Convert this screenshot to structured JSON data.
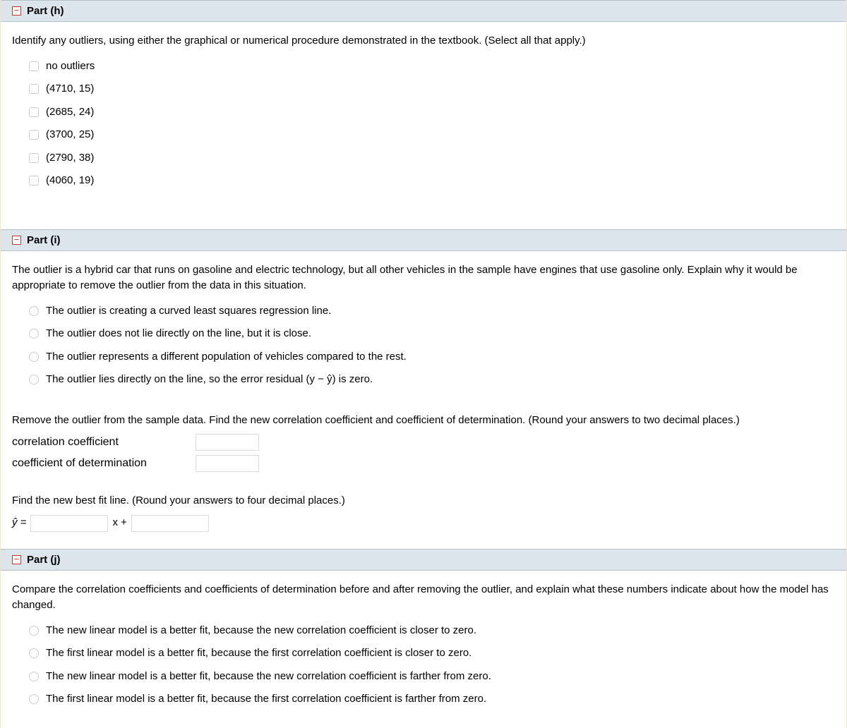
{
  "parts": {
    "h": {
      "title": "Part (h)",
      "question": "Identify any outliers, using either the graphical or numerical procedure demonstrated in the textbook. (Select all that apply.)",
      "options": [
        "no outliers",
        "(4710, 15)",
        "(2685, 24)",
        "(3700, 25)",
        "(2790, 38)",
        "(4060, 19)"
      ]
    },
    "i": {
      "title": "Part (i)",
      "question": "The outlier is a hybrid car that runs on gasoline and electric technology, but all other vehicles in the sample have engines that use gasoline only. Explain why it would be appropriate to remove the outlier from the data in this situation.",
      "options": [
        "The outlier is creating a curved least squares regression line.",
        "The outlier does not lie directly on the line, but it is close.",
        "The outlier represents a different population of vehicles compared to the rest.",
        "The outlier lies directly on the line, so the error residual (y − ŷ) is zero."
      ],
      "coeff_prompt": "Remove the outlier from the sample data. Find the new correlation coefficient and coefficient of determination. (Round your answers to two decimal places.)",
      "corr_label": "correlation coefficient",
      "det_label": "coefficient of determination",
      "bestfit_prompt": "Find the new best fit line. (Round your answers to four decimal places.)",
      "yhat_label": "ŷ =",
      "xplus_label": "x +"
    },
    "j": {
      "title": "Part (j)",
      "question": "Compare the correlation coefficients and coefficients of determination before and after removing the outlier, and explain what these numbers indicate about how the model has changed.",
      "options": [
        "The new linear model is a better fit, because the new correlation coefficient is closer to zero.",
        "The first linear model is a better fit, because the first correlation coefficient is closer to zero.",
        "The new linear model is a better fit, because the new correlation coefficient is farther from zero.",
        "The first linear model is a better fit, because the first correlation coefficient is farther from zero."
      ]
    }
  }
}
